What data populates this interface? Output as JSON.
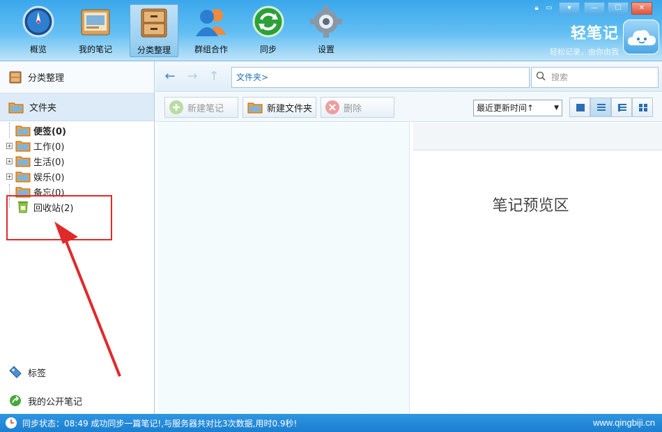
{
  "toolbar": {
    "items": [
      {
        "label": "概览",
        "icon": "compass-icon"
      },
      {
        "label": "我的笔记",
        "icon": "notebook-icon"
      },
      {
        "label": "分类整理",
        "icon": "cabinet-icon"
      },
      {
        "label": "群组合作",
        "icon": "group-icon"
      },
      {
        "label": "同步",
        "icon": "sync-icon"
      },
      {
        "label": "设置",
        "icon": "gear-icon"
      }
    ],
    "active_index": 2,
    "brand_name": "轻笔记",
    "brand_slogan": "轻松记录，由你由我"
  },
  "window": {
    "buttons": [
      "▾",
      "—",
      "☐",
      "✕"
    ]
  },
  "sidebar": {
    "header": "分类整理",
    "folder_header": "文件夹",
    "tree": [
      {
        "label": "便签(0)",
        "bold": true,
        "expandable": false
      },
      {
        "label": "工作(0)",
        "bold": false,
        "expandable": true
      },
      {
        "label": "生活(0)",
        "bold": false,
        "expandable": true
      },
      {
        "label": "娱乐(0)",
        "bold": false,
        "expandable": true
      },
      {
        "label": "备忘(0)",
        "bold": false,
        "expandable": false
      },
      {
        "label": "回收站(2)",
        "bold": false,
        "expandable": false
      }
    ],
    "tags_label": "标签",
    "public_notes_label": "我的公开笔记"
  },
  "navbar": {
    "path": "文件夹>",
    "search_placeholder": "搜索"
  },
  "actions": {
    "new_note": "新建笔记",
    "new_folder": "新建文件夹",
    "delete": "删除",
    "sort_label": "最近更新时间↑"
  },
  "preview": {
    "label": "笔记预览区"
  },
  "status": {
    "text": "同步状态：08:49 成功同步一篇笔记!,与服务器共对比3次数据,用时0.9秒!",
    "website": "www.qingbiji.cn"
  },
  "colors": {
    "accent": "#2f96e2",
    "annotation": "#e02a2a"
  }
}
